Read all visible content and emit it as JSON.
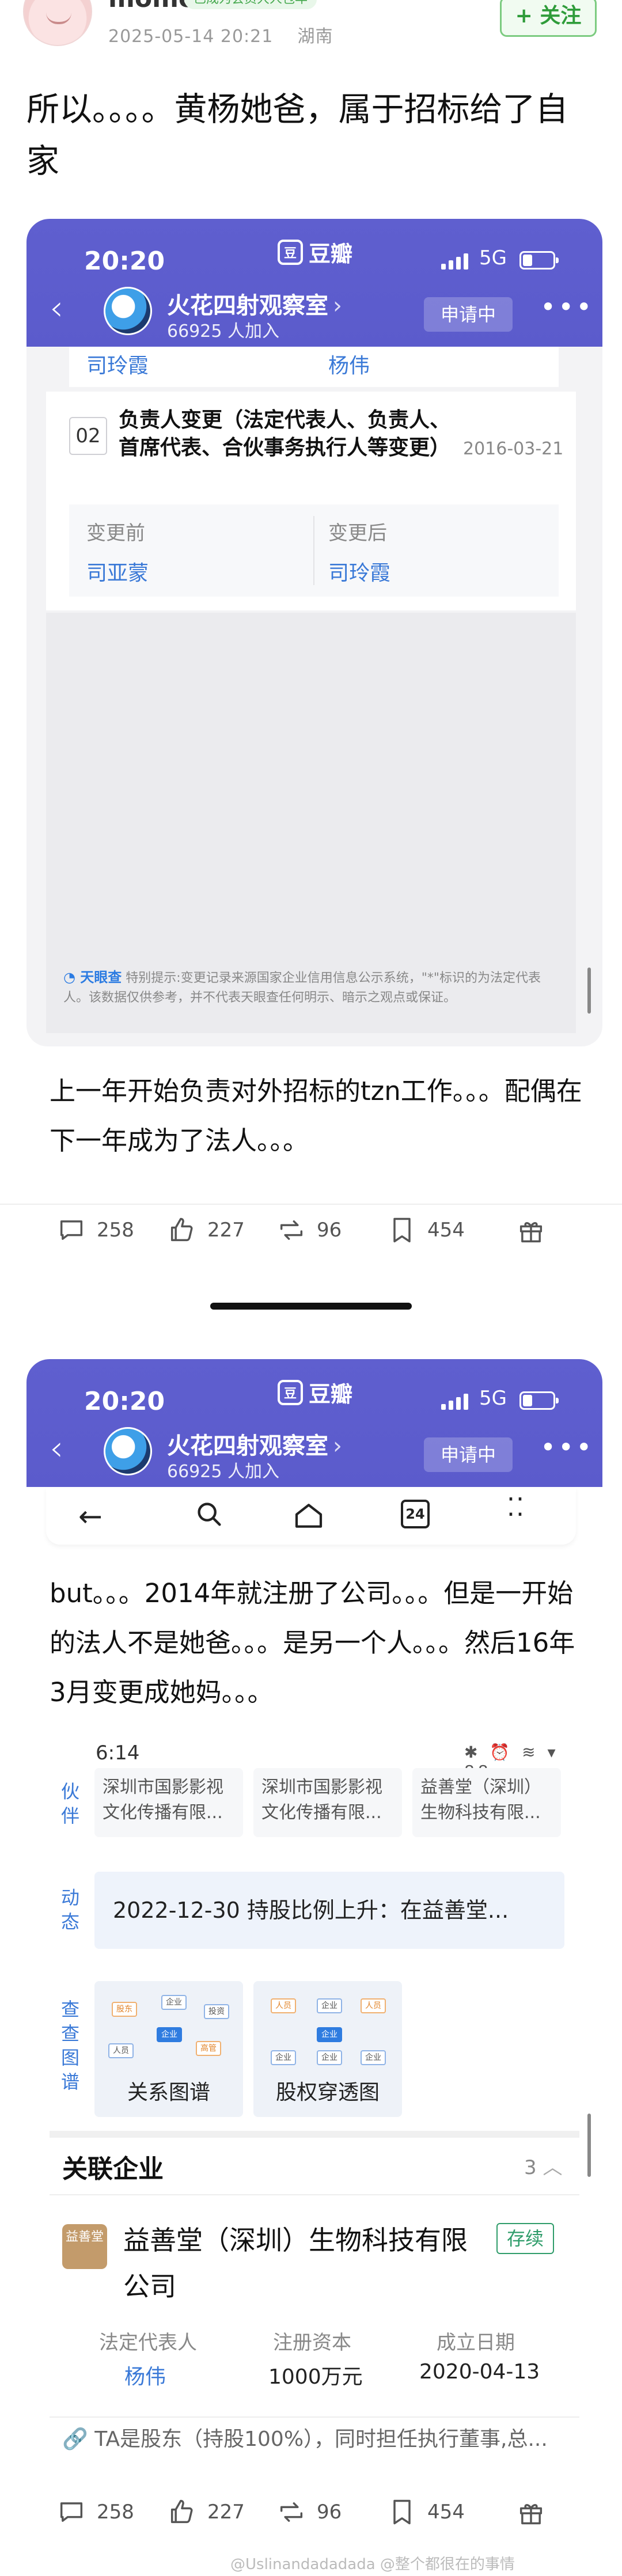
{
  "post": {
    "username": "momo",
    "vip_badge": "已成为会员大人包年",
    "date": "2025-05-14 20:21",
    "location": "湖南",
    "follow_label": "+ 关注",
    "text1": "所以。。。。黄杨她爸，属于招标给了自家",
    "text2": "上一年开始负责对外招标的tzn工作。。。配偶在下一年成为了法人。。。",
    "text3": "but。。。2014年就注册了公司。。。但是一开始的法人不是她爸。。。是另一个人。。。然后16年3月变更成她妈。。。"
  },
  "douban": {
    "time": "20:20",
    "app_name": "豆瓣",
    "logo_char": "豆",
    "network": "5G",
    "group_name": "火花四射观察室",
    "members": "66925 人加入",
    "apply_label": "申请中",
    "more_label": "•••"
  },
  "change_record": {
    "prev_after_values": [
      "司玲霞",
      "杨伟"
    ],
    "index": "02",
    "title": "负责人变更（法定代表人、负责人、首席代表、合伙事务执行人等变更）",
    "date": "2016-03-21",
    "before_label": "变更前",
    "after_label": "变更后",
    "before_value": "司亚蒙",
    "after_value": "司玲霞"
  },
  "tianyancha": {
    "brand": "天眼查",
    "note": "特别提示:变更记录来源国家企业信用信息公示系统，\"*\"标识的为法定代表人。该数据仅供参考，并不代表天眼查任何明示、暗示之观点或保证。"
  },
  "actions": {
    "comments": "258",
    "likes": "227",
    "reposts": "96",
    "favorites": "454"
  },
  "browser": {
    "tabs_count": "24"
  },
  "company_app": {
    "time": "6:14",
    "status_icons": "✱ ⏰ ≋ ▾ 88",
    "partner_tag": "伙伴",
    "partners": [
      "深圳市国影影视文化传播有限...",
      "深圳市国影影视文化传播有限...",
      "益善堂（深圳）生物科技有限..."
    ],
    "dynamic_tag": "动态",
    "dynamic_text": "2022-12-30 持股比例上升：在益善堂...",
    "graph_tag": "查查图谱",
    "graph_cards": [
      "关系图谱",
      "股权穿透图"
    ],
    "graph_nodes": [
      "股东",
      "企业",
      "投资",
      "企业",
      "人员",
      "企业",
      "高管",
      "企业"
    ],
    "related_title": "关联企业",
    "related_count": "3",
    "company_logo_text": "益善堂",
    "company_name": "益善堂（深圳）生物科技有限公司",
    "company_status": "存续",
    "legal_rep_label": "法定代表人",
    "legal_rep": "杨伟",
    "capital_label": "注册资本",
    "capital": "1000万元",
    "established_label": "成立日期",
    "established": "2020-04-13",
    "ta_line": "TA是股东（持股100%），同时担任执行董事,总..."
  },
  "watermark": "@Uslinandadadada   @整个都很在的事情"
}
